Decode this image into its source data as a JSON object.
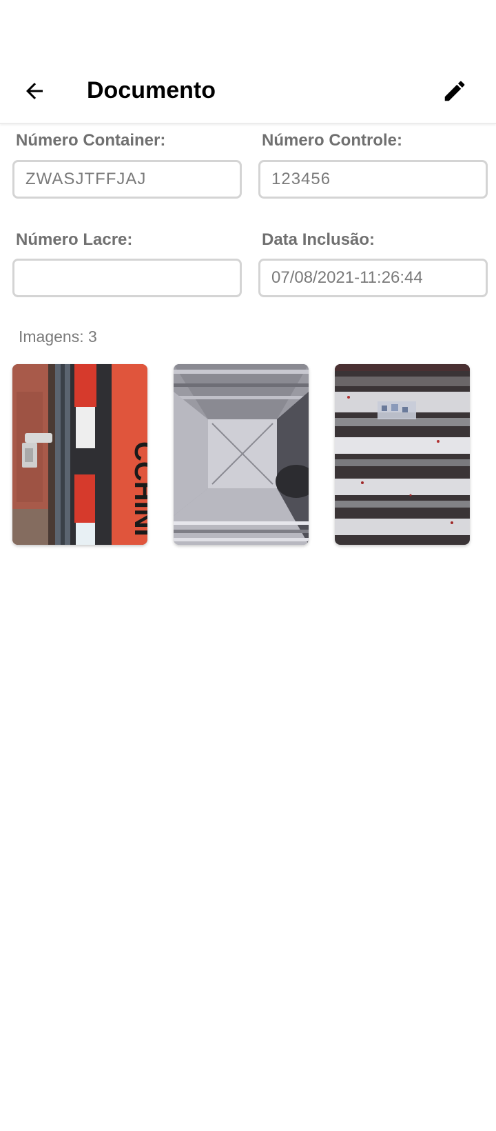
{
  "app_bar": {
    "title": "Documento",
    "back_icon": "arrow-back-icon",
    "edit_icon": "pencil-edit-icon"
  },
  "form": {
    "container": {
      "label": "Número Container:",
      "value": "ZWASJTFFJAJ"
    },
    "controle": {
      "label": "Número Controle:",
      "value": "123456"
    },
    "lacre": {
      "label": "Número Lacre:",
      "value": ""
    },
    "data_inclusao": {
      "label": "Data Inclusão:",
      "value": "07/08/2021-11:26:44"
    }
  },
  "images": {
    "count_text": "Imagens: 3",
    "thumb1_lettering": "CCHINI"
  },
  "colors": {
    "label_gray": "#707070",
    "value_gray": "#7a7a7a",
    "field_border": "#d4d4d4",
    "container_red": "#d9442f"
  }
}
